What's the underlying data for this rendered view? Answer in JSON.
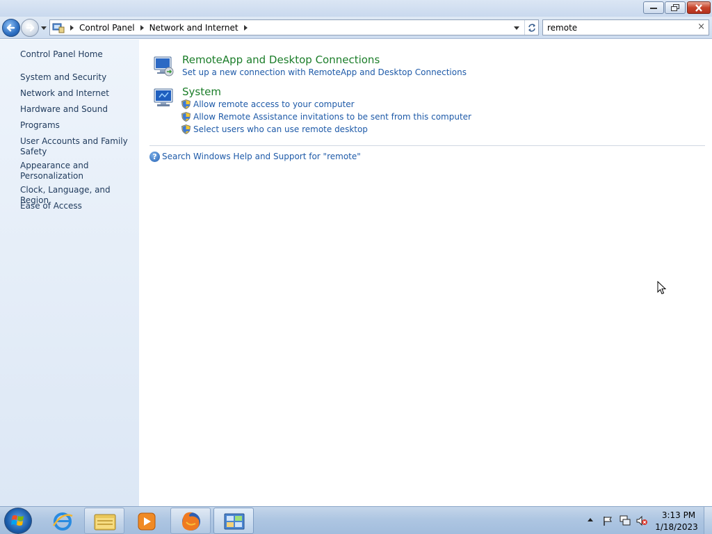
{
  "address_bar": {
    "crumbs": [
      "Control Panel",
      "Network and Internet"
    ]
  },
  "search": {
    "value": "remote",
    "clear_glyph": "×"
  },
  "sidebar": {
    "items": [
      {
        "label": "Control Panel Home"
      },
      {
        "label": "System and Security"
      },
      {
        "label": "Network and Internet"
      },
      {
        "label": "Hardware and Sound"
      },
      {
        "label": "Programs"
      },
      {
        "label": "User Accounts and Family Safety"
      },
      {
        "label": "Appearance and Personalization"
      },
      {
        "label": "Clock, Language, and Region"
      },
      {
        "label": "Ease of Access"
      }
    ]
  },
  "results": [
    {
      "title": "RemoteApp and Desktop Connections",
      "tasks": [
        {
          "label": "Set up a new connection with RemoteApp and Desktop Connections",
          "shield": false
        }
      ]
    },
    {
      "title": "System",
      "tasks": [
        {
          "label": "Allow remote access to your computer",
          "shield": true
        },
        {
          "label": "Allow Remote Assistance invitations to be sent from this computer",
          "shield": true
        },
        {
          "label": "Select users who can use remote desktop",
          "shield": true
        }
      ]
    }
  ],
  "help": {
    "label": "Search Windows Help and Support for \"remote\""
  },
  "taskbar": {
    "items": [
      {
        "name": "internet-explorer",
        "icon": "ie-icon"
      },
      {
        "name": "windows-explorer",
        "icon": "folder-icon"
      },
      {
        "name": "media-player",
        "icon": "media-player-icon"
      },
      {
        "name": "firefox",
        "icon": "firefox-icon"
      },
      {
        "name": "control-panel",
        "icon": "control-panel-icon"
      }
    ],
    "clock": {
      "time": "3:13 PM",
      "date": "1/18/2023"
    }
  },
  "colors": {
    "category_title": "#1b7d29",
    "link": "#1e5aa8",
    "sidebar_text": "#1e395b",
    "close_button": "#c6442c"
  }
}
